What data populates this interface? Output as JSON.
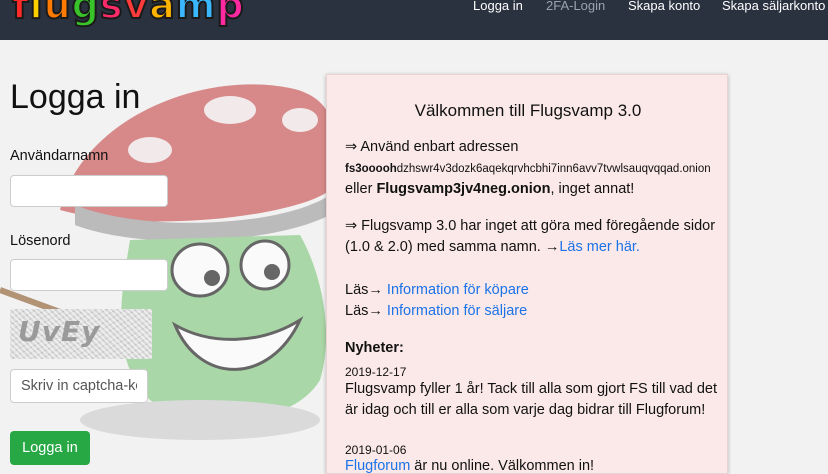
{
  "navbar": {
    "logo_letters": [
      "f",
      "l",
      "u",
      "g",
      "s",
      "v",
      "a",
      "m",
      "p"
    ],
    "logo_colors": [
      "#ff2a2a",
      "#ffd000",
      "#ff7a00",
      "#39c32a",
      "#ff2a6a",
      "#ff3a3a",
      "#ffb400",
      "#3ab7ff",
      "#ff2aa0"
    ],
    "links": [
      {
        "label": "Logga in"
      },
      {
        "label": "2FA-Login"
      },
      {
        "label": "Skapa konto"
      },
      {
        "label": "Skapa säljarkonto"
      }
    ]
  },
  "login": {
    "title": "Logga in",
    "username_label": "Användarnamn",
    "username_value": "",
    "password_label": "Lösenord",
    "password_value": "",
    "captcha_text": "UvEy",
    "captcha_placeholder": "Skriv in captcha-kod",
    "submit_label": "Logga in"
  },
  "welcome": {
    "title": "Välkommen till Flugsvamp 3.0",
    "p1_line1": "⇒ Använd enbart adressen",
    "onion_bold_prefix": "fs3ooooh",
    "onion_rest": "dzhswr4v3dozk6aqekqrvhcbhi7inn6avv7tvwlsauqvqqad.onion",
    "p1_line3_pre": "eller ",
    "onion_short": "Flugsvamp3jv4neg.onion",
    "p1_line3_post": ", inget annat!",
    "p2_line1": "⇒ Flugsvamp 3.0 har inget att göra med föregående sidor",
    "p2_line2_pre": "(1.0 & 2.0) med samma namn. →",
    "p2_link": "Läs mer här.",
    "read1_pre": "Läs→ ",
    "read1_link": "Information för köpare",
    "read2_pre": "Läs→ ",
    "read2_link": "Information för säljare",
    "news_heading": "Nyheter:",
    "news": [
      {
        "date": "2019-12-17",
        "line1": "Flugsvamp fyller 1 år! Tack till alla som gjort FS till vad det",
        "line2": "är idag och till er alla som varje dag bidrar till Flugforum!"
      },
      {
        "date": "2019-01-06",
        "link": "Flugforum",
        "text": " är nu online. Välkommen in!"
      }
    ]
  },
  "colors": {
    "navbar_bg": "#2a3240",
    "link": "#1a73e8",
    "button_green": "#28a745",
    "panel_bg": "#fbe9e9"
  }
}
